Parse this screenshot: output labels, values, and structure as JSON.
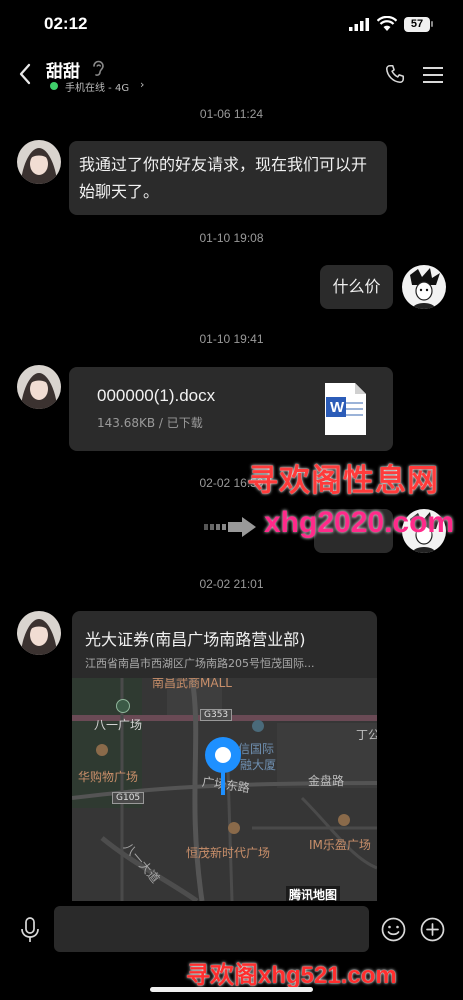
{
  "status_bar": {
    "time": "02:12",
    "battery": "57"
  },
  "header": {
    "contact_name": "甜甜",
    "online_status": "手机在线 - 4G",
    "status_chevron": "›"
  },
  "messages": {
    "ts1": "01-06 11:24",
    "msg1_text": "我通过了你的好友请求，现在我们可以开始聊天了。",
    "ts2": "01-10 19:08",
    "msg2_text": "什么价",
    "ts3": "01-10 19:41",
    "file": {
      "name": "000000(1).docx",
      "meta": "143.68KB / 已下载",
      "icon": "W"
    },
    "ts4": "02-02 16:59",
    "ts5": "02-02 21:01",
    "location": {
      "title": "光大证券(南昌广场南路营业部)",
      "address": "江西省南昌市西湖区广场南路205号恒茂国际...",
      "map_labels": {
        "mall": "南昌武商MALL",
        "bayi": "八一广场",
        "g353": "G353",
        "xinxin": "信国际",
        "rongda": "融大厦",
        "dingg": "丁公",
        "guangchang_east": "广场东路",
        "jinpan": "金盘路",
        "huagou": "华购物广场",
        "g105": "G105",
        "hengmao": "恒茂新时代广场",
        "im": "IM乐盈广场",
        "bayi_road": "八一大道",
        "tencent": "腾讯地图"
      }
    }
  },
  "watermarks": {
    "top_text": "寻欢阁性息网",
    "mid_text": "xhg2020.com",
    "bottom_text": "寻欢阁xhg521.com"
  },
  "colors": {
    "background": "#000000",
    "bubble": "#2b2b2b",
    "online": "#3fcf6a",
    "pin": "#1e90ff"
  }
}
